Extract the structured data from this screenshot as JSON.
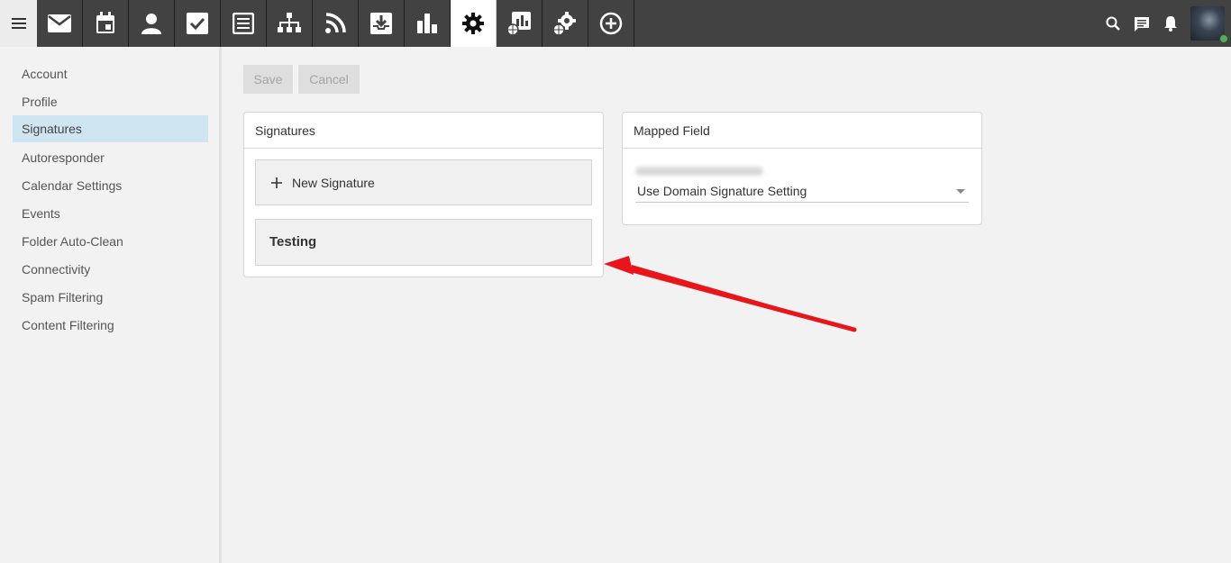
{
  "topbar": {
    "menu_icon": "hamburger-icon",
    "apps": [
      {
        "icon": "mail-icon",
        "active": false
      },
      {
        "icon": "calendar-icon",
        "active": false
      },
      {
        "icon": "contacts-icon",
        "active": false
      },
      {
        "icon": "tasks-icon",
        "active": false
      },
      {
        "icon": "notes-icon",
        "active": false
      },
      {
        "icon": "sitemap-icon",
        "active": false
      },
      {
        "icon": "rss-icon",
        "active": false
      },
      {
        "icon": "download-tray-icon",
        "active": false
      },
      {
        "icon": "reports-icon",
        "active": false
      },
      {
        "icon": "settings-gear-icon",
        "active": true
      },
      {
        "icon": "domain-reports-icon",
        "active": false
      },
      {
        "icon": "domain-settings-icon",
        "active": false
      },
      {
        "icon": "add-circle-icon",
        "active": false
      }
    ],
    "tools": [
      "search-icon",
      "chat-icon",
      "bell-icon"
    ],
    "status_color": "#4caf50"
  },
  "sidebar": {
    "items": [
      {
        "label": "Account",
        "active": false
      },
      {
        "label": "Profile",
        "active": false
      },
      {
        "label": "Signatures",
        "active": true
      },
      {
        "label": "Autoresponder",
        "active": false
      },
      {
        "label": "Calendar Settings",
        "active": false
      },
      {
        "label": "Events",
        "active": false
      },
      {
        "label": "Folder Auto-Clean",
        "active": false
      },
      {
        "label": "Connectivity",
        "active": false
      },
      {
        "label": "Spam Filtering",
        "active": false
      },
      {
        "label": "Content Filtering",
        "active": false
      }
    ]
  },
  "toolbar": {
    "save_label": "Save",
    "cancel_label": "Cancel"
  },
  "signatures_card": {
    "title": "Signatures",
    "new_label": "New Signature",
    "items": [
      "Testing"
    ]
  },
  "mapped_card": {
    "title": "Mapped Field",
    "select_value": "Use Domain Signature Setting"
  },
  "colors": {
    "accent_highlight": "#cfe5f2",
    "annotation_arrow": "#e8161a",
    "topbar": "#424242"
  }
}
